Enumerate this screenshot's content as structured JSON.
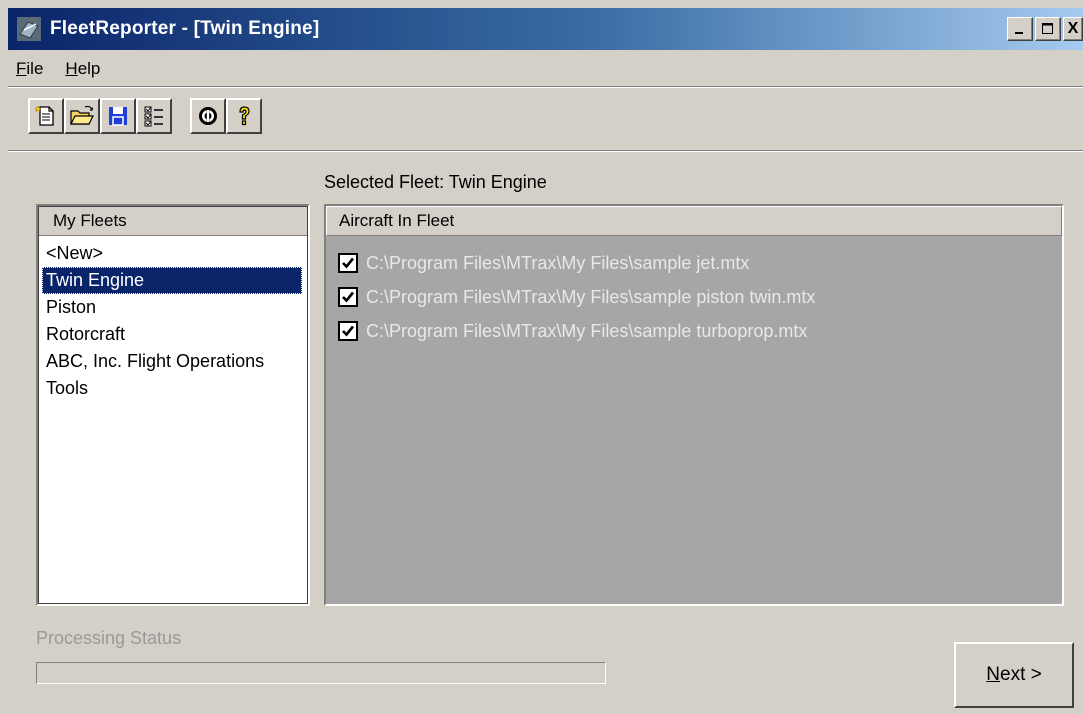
{
  "window": {
    "title": "FleetReporter - [Twin Engine]",
    "controls": {
      "minimize": "_",
      "maximize": "□",
      "close": "X"
    }
  },
  "menu": {
    "file": {
      "accel": "F",
      "rest": "ile"
    },
    "help": {
      "accel": "H",
      "rest": "elp"
    }
  },
  "toolbar": {
    "icons": [
      "new-document-icon",
      "open-folder-icon",
      "save-icon",
      "checklist-icon",
      "lifebuoy-icon",
      "help-question-icon"
    ]
  },
  "selected_fleet": "Selected Fleet: Twin Engine",
  "fleets": {
    "header": "My Fleets",
    "items": [
      "<New>",
      "Twin Engine",
      "Piston",
      "Rotorcraft",
      "ABC, Inc. Flight Operations",
      "Tools"
    ],
    "selected_index": 1
  },
  "aircraft": {
    "header": "Aircraft In Fleet",
    "items": [
      {
        "path": "C:\\Program Files\\MTrax\\My Files\\sample jet.mtx",
        "checked": true
      },
      {
        "path": "C:\\Program Files\\MTrax\\My Files\\sample piston twin.mtx",
        "checked": true
      },
      {
        "path": "C:\\Program Files\\MTrax\\My Files\\sample turboprop.mtx",
        "checked": true
      }
    ]
  },
  "status": {
    "label": "Processing Status",
    "progress": 0
  },
  "next_button": {
    "accel": "N",
    "rest": "ext >"
  },
  "colors": {
    "title_gradient_start": "#0a246a",
    "title_gradient_end": "#a6caf0",
    "selection": "#0a246a",
    "aircraft_panel_bg": "#a6a6a6"
  }
}
